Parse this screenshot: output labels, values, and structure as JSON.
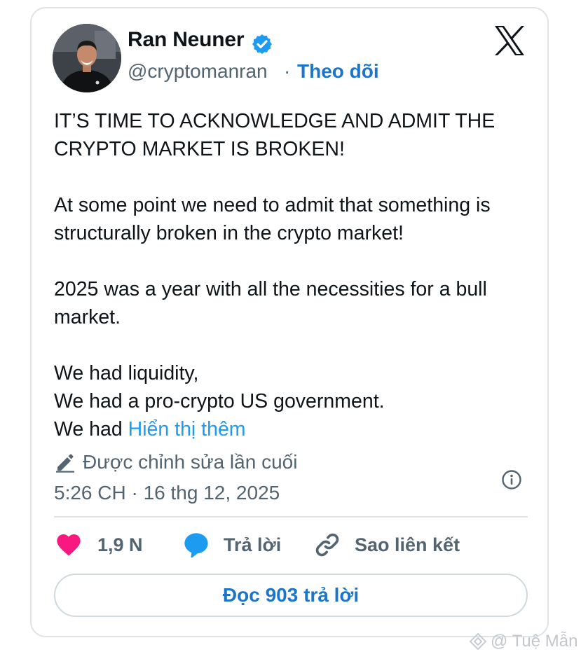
{
  "author": {
    "name": "Ran Neuner",
    "handle": "@cryptomanran",
    "separator": "·",
    "follow_label": "Theo dõi"
  },
  "tweet": {
    "paragraphs": [
      [
        "IT’S TIME TO ACKNOWLEDGE AND ADMIT THE",
        "CRYPTO MARKET IS BROKEN!"
      ],
      [
        "At some point we need to admit that something is",
        "structurally broken in the crypto market!"
      ],
      [
        "2025 was a year with all the necessities for a bull",
        "market."
      ],
      [
        "We had liquidity,",
        "We had a pro-crypto US government."
      ]
    ],
    "last_line_prefix": "We had ",
    "show_more_label": "Hiển thị thêm"
  },
  "meta": {
    "edited_label": "Được chỉnh sửa lần cuối",
    "timestamp": "5:26 CH · 16 thg 12, 2025"
  },
  "actions": {
    "likes_count": "1,9 N",
    "reply_label": "Trả lời",
    "copy_link_label": "Sao liên kết"
  },
  "read_replies_label": "Đọc 903 trả lời",
  "watermark": "@ Tuệ Mẫn",
  "colors": {
    "like": "#f91880",
    "reply": "#1d9bf0",
    "link": "#1d75c9",
    "secondary_text": "#536471",
    "verified": "#1d9bf0"
  }
}
